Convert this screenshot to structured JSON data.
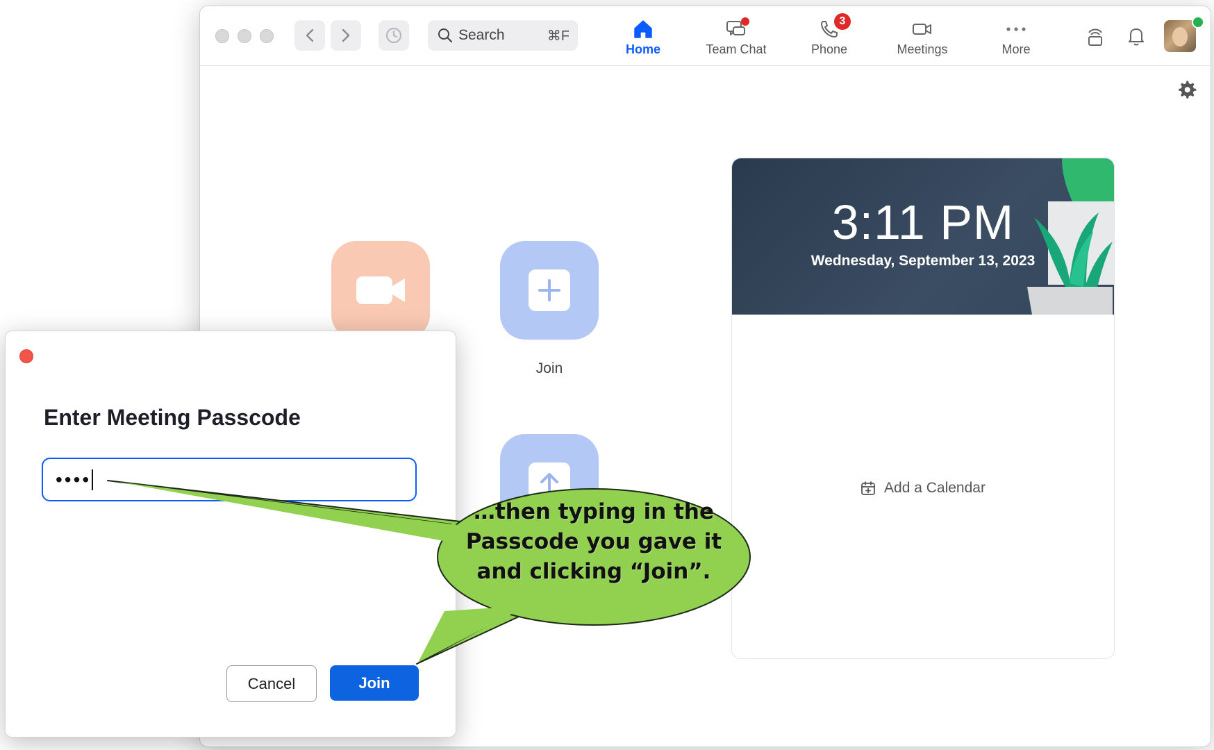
{
  "topbar": {
    "search_label": "Search",
    "search_shortcut": "⌘F",
    "tabs": [
      {
        "label": "Home",
        "active": true
      },
      {
        "label": "Team Chat"
      },
      {
        "label": "Phone",
        "badge": "3"
      },
      {
        "label": "Meetings"
      },
      {
        "label": "More"
      }
    ]
  },
  "home": {
    "join_label": "Join"
  },
  "calendar": {
    "time": "3:11 PM",
    "date": "Wednesday, September 13, 2023",
    "add_calendar_label": "Add a Calendar"
  },
  "dialog": {
    "title": "Enter Meeting Passcode",
    "passcode_value": "••••",
    "cancel_label": "Cancel",
    "join_label": "Join"
  },
  "callout": {
    "text": "…then typing in the Passcode you gave it and clicking “Join”."
  },
  "colors": {
    "accent": "#0b5cff",
    "join_button": "#0e63e0",
    "new_meeting_tile": "#f9c9b4",
    "join_tile": "#b3c8f5",
    "callout_fill": "#92d050",
    "badge": "#e02828"
  }
}
